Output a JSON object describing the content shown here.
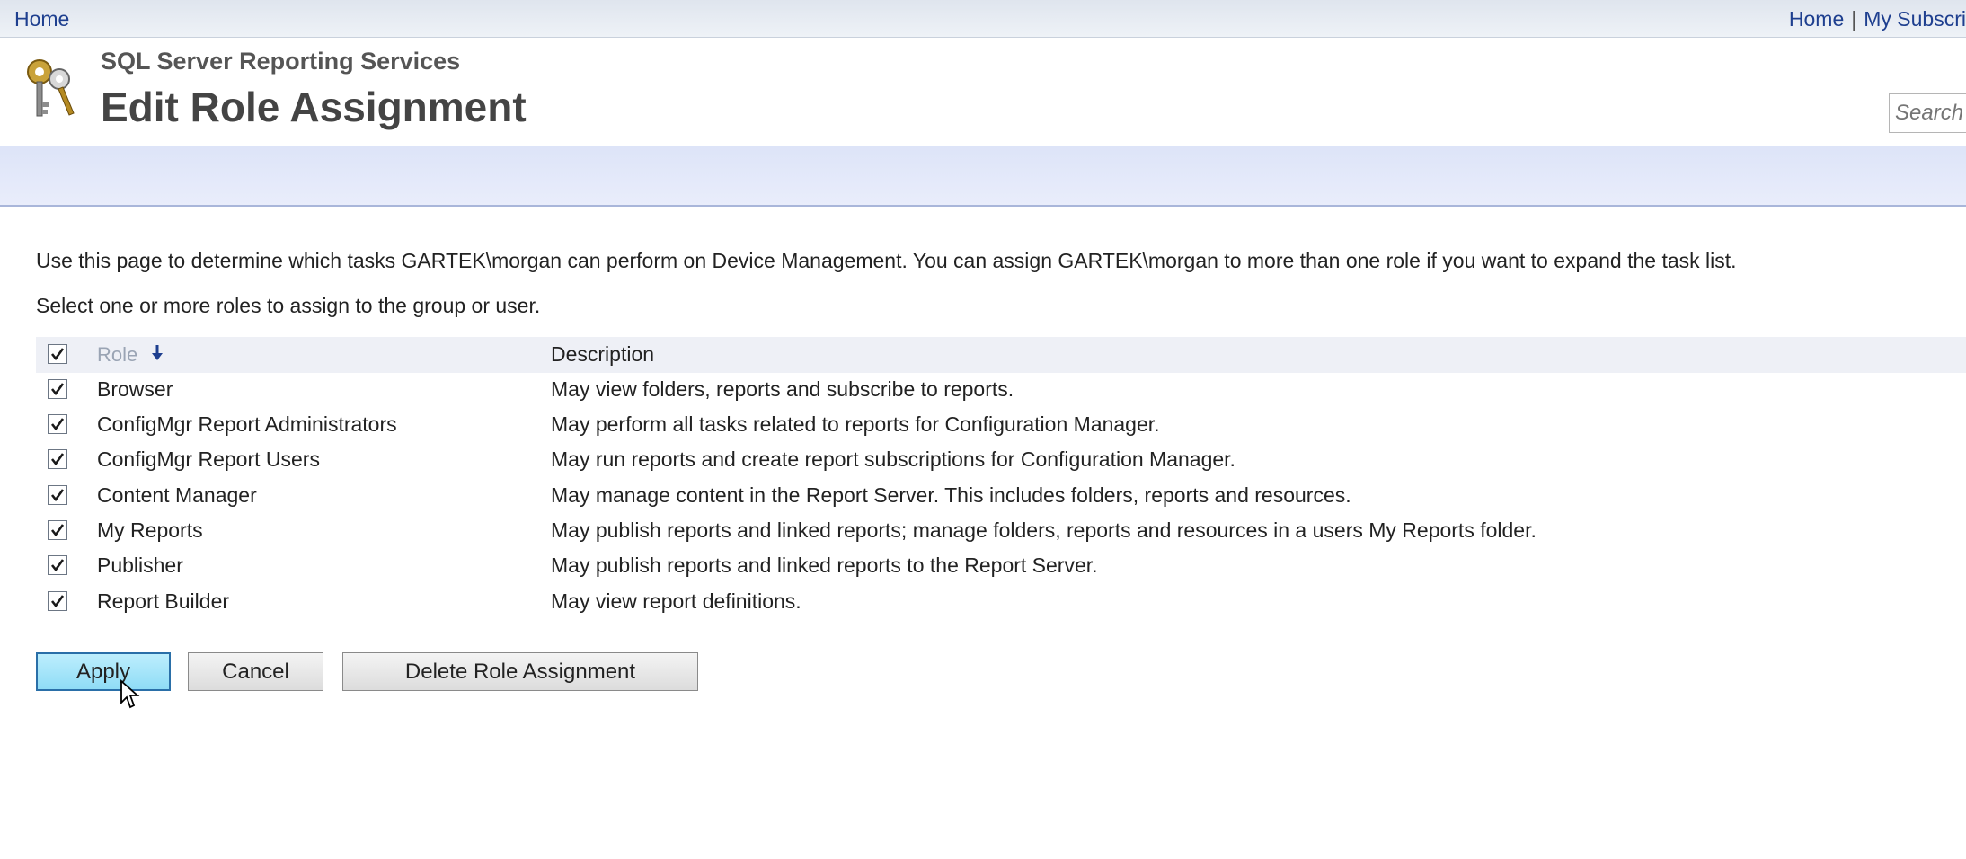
{
  "topbar": {
    "home_label": "Home",
    "right_home_label": "Home",
    "separator": "|",
    "my_subscriptions_label": "My Subscri"
  },
  "header": {
    "app_name": "SQL Server Reporting Services",
    "page_title": "Edit Role Assignment",
    "search_placeholder": "Search"
  },
  "content": {
    "intro_text": "Use this page to determine which tasks GARTEK\\morgan can perform on Device Management. You can assign GARTEK\\morgan to more than one role if you want to expand the task list.",
    "select_text": "Select one or more roles to assign to the group or user.",
    "table": {
      "header_role": "Role",
      "header_description": "Description",
      "select_all_checked": true,
      "rows": [
        {
          "role": "Browser",
          "description": "May view folders, reports and subscribe to reports.",
          "checked": true
        },
        {
          "role": "ConfigMgr Report Administrators",
          "description": "May perform all tasks related to reports for Configuration Manager.",
          "checked": true
        },
        {
          "role": "ConfigMgr Report Users",
          "description": "May run reports and create report subscriptions for Configuration Manager.",
          "checked": true
        },
        {
          "role": "Content Manager",
          "description": "May manage content in the Report Server.  This includes folders, reports and resources.",
          "checked": true
        },
        {
          "role": "My Reports",
          "description": "May publish reports and linked reports; manage folders, reports and resources in a users My Reports folder.",
          "checked": true
        },
        {
          "role": "Publisher",
          "description": "May publish reports and linked reports to the Report Server.",
          "checked": true
        },
        {
          "role": "Report Builder",
          "description": "May view report definitions.",
          "checked": true
        }
      ]
    }
  },
  "buttons": {
    "apply": "Apply",
    "cancel": "Cancel",
    "delete": "Delete Role Assignment"
  },
  "colors": {
    "link_blue": "#1e3f8f",
    "band_blue": "#dde4f8",
    "apply_button": "#8fdcf6"
  },
  "icons": {
    "header_icon": "keys-icon",
    "sort_icon": "arrow-down-icon",
    "check_icon": "checkmark-icon",
    "cursor_icon": "mouse-pointer-icon"
  }
}
